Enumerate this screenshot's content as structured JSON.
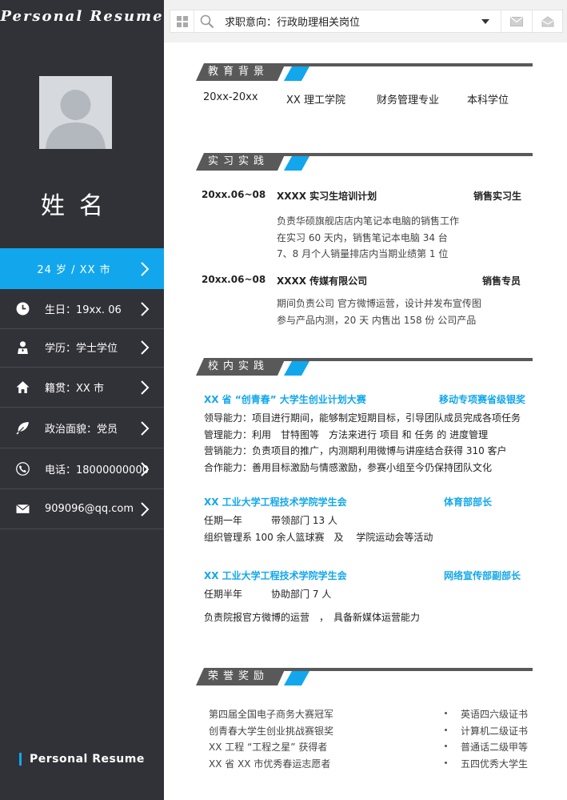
{
  "sidebar": {
    "top_title": "Personal  Resume",
    "name": "姓名",
    "highlight": "24 岁  / XX 市",
    "items": [
      {
        "icon": "clock-icon",
        "label": "生日：19xx. 06"
      },
      {
        "icon": "person-icon",
        "label": "学历：学士学位"
      },
      {
        "icon": "home-icon",
        "label": "籍贯：XX 市"
      },
      {
        "icon": "leaf-icon",
        "label": "政治面貌：党员"
      },
      {
        "icon": "phone-icon",
        "label": "电话：18000000000"
      },
      {
        "icon": "mail-icon",
        "label": "909096@qq.com"
      }
    ],
    "bottom_title": "Personal  Resume"
  },
  "search": {
    "text": "求职意向：行政助理相关岗位",
    "icons": [
      "windows-icon",
      "search-icon",
      "dropdown-arrow-icon",
      "mail-icon",
      "inbox-icon"
    ]
  },
  "education": {
    "title": "教育背景",
    "period": "20xx-20xx",
    "school": "XX 理工学院",
    "major": "财务管理专业",
    "degree": "本科学位"
  },
  "internship": {
    "title": "实习实践",
    "entries": [
      {
        "date": "20xx.06~08",
        "org": "XXXX 实习生培训计划",
        "role": "销售实习生",
        "lines": [
          "负责华硕旗舰店店内笔记本电脑的销售工作",
          "在实习 60 天内，销售笔记本电脑 34 台",
          "7、8 月个人销量排店内当期业绩第 1 位"
        ]
      },
      {
        "date": "20xx.06~08",
        "org": "XXXX 传媒有限公司",
        "role": "销售专员",
        "lines": [
          "期间负责公司 官方微博运营，设计并发布宣传图",
          "参与产品内测，20 天 内售出 158 份 公司产品"
        ]
      }
    ]
  },
  "campus": {
    "title": "校内实践",
    "block1": {
      "org": "XX 省 “创青春” 大学生创业计划大赛",
      "award": "移动专项赛省级银奖",
      "lines": [
        "领导能力：项目进行期间，能够制定短期目标，引导团队成员完成各项任务",
        "管理能力：利用　甘特图等　方法来进行 项目 和 任务 的 进度管理",
        "营销能力：负责项目的推广，内测期利用微博与讲座结合获得 310 客户",
        "合作能力：善用目标激励与情感激励，参赛小组至今仍保持团队文化"
      ]
    },
    "block2": {
      "org": "XX 工业大学工程技术学院学生会",
      "role": "体育部部长",
      "lines": [
        "任期一年　　　带领部门 13 人",
        "组织管理系 100 余人篮球赛　及　 学院运动会等活动"
      ]
    },
    "block3": {
      "org": "XX 工业大学工程技术学院学生会",
      "role": "网络宣传部副部长",
      "lines": [
        "任期半年　　　协助部门 7 人",
        "负责院报官方微博的运营　，　具备新媒体运营能力"
      ]
    }
  },
  "awards": {
    "title": "荣誉奖励",
    "left": [
      "第四届全国电子商务大赛冠军",
      "创青春大学生创业挑战赛银奖",
      "XX 工程 “工程之星” 获得者",
      "XX 省 XX 市优秀春运志愿者"
    ],
    "right": [
      "英语四六级证书",
      "计算机二级证书",
      "普通话二级甲等",
      "五四优秀大学生"
    ]
  },
  "colors": {
    "sidebar": "#313138",
    "accent": "#12a7ec",
    "header": "#595959"
  }
}
